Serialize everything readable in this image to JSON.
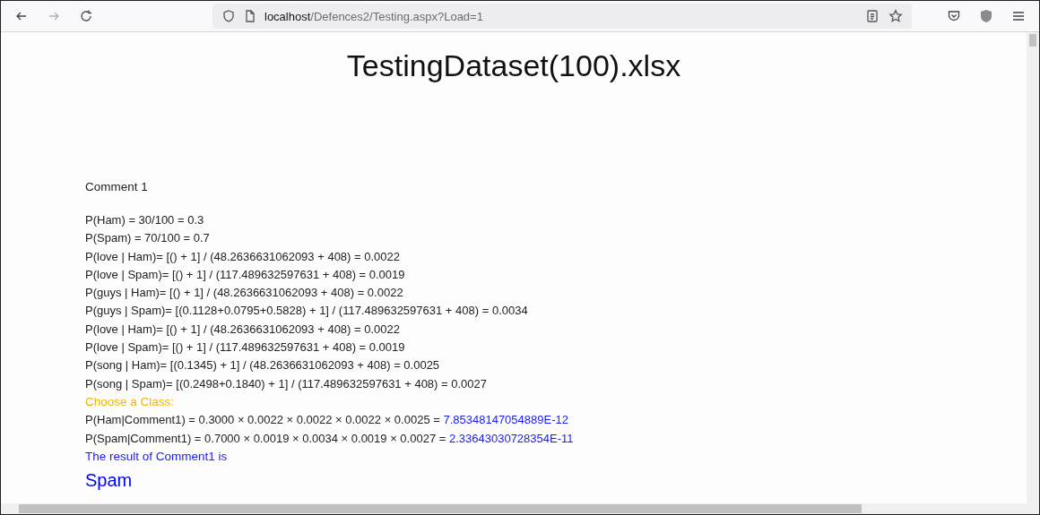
{
  "browser": {
    "url_host": "localhost",
    "url_path": "/Defences2/Testing.aspx?Load=1"
  },
  "page": {
    "title": "TestingDataset(100).xlsx",
    "comment_heading": "Comment 1",
    "lines": [
      {
        "kind": "formula",
        "text": "P(Ham) = 30/100 = 0.3"
      },
      {
        "kind": "formula",
        "text": "P(Spam) = 70/100 = 0.7"
      },
      {
        "kind": "formula",
        "text": "P(love | Ham)= [() + 1] / (48.2636631062093 + 408) = 0.0022"
      },
      {
        "kind": "formula",
        "text": "P(love | Spam)= [() + 1] / (117.489632597631 + 408) = 0.0019"
      },
      {
        "kind": "formula",
        "text": "P(guys | Ham)= [() + 1] / (48.2636631062093 + 408) = 0.0022"
      },
      {
        "kind": "formula",
        "text": "P(guys | Spam)= [(0.1128+0.0795+0.5828) + 1] / (117.489632597631 + 408) = 0.0034"
      },
      {
        "kind": "formula",
        "text": "P(love | Ham)= [() + 1] / (48.2636631062093 + 408) = 0.0022"
      },
      {
        "kind": "formula",
        "text": "P(love | Spam)= [() + 1] / (117.489632597631 + 408) = 0.0019"
      },
      {
        "kind": "formula",
        "text": "P(song | Ham)= [(0.1345) + 1] / (48.2636631062093 + 408) = 0.0025"
      },
      {
        "kind": "formula",
        "text": "P(song | Spam)= [(0.2498+0.1840) + 1] / (117.489632597631 + 408) = 0.0027"
      },
      {
        "kind": "heading",
        "text": "Choose a Class:"
      },
      {
        "kind": "product",
        "text": "P(Ham|Comment1) = 0.3000 × 0.0022 × 0.0022 × 0.0022 × 0.0025 = ",
        "result": "7.85348147054889E-12"
      },
      {
        "kind": "product",
        "text": "P(Spam|Comment1) = 0.7000 × 0.0019 × 0.0034 × 0.0019 × 0.0027 = ",
        "result": "2.33643030728354E-11"
      },
      {
        "kind": "verdict_label",
        "text": "The result of Comment1 is"
      },
      {
        "kind": "verdict",
        "text": "Spam"
      }
    ]
  }
}
